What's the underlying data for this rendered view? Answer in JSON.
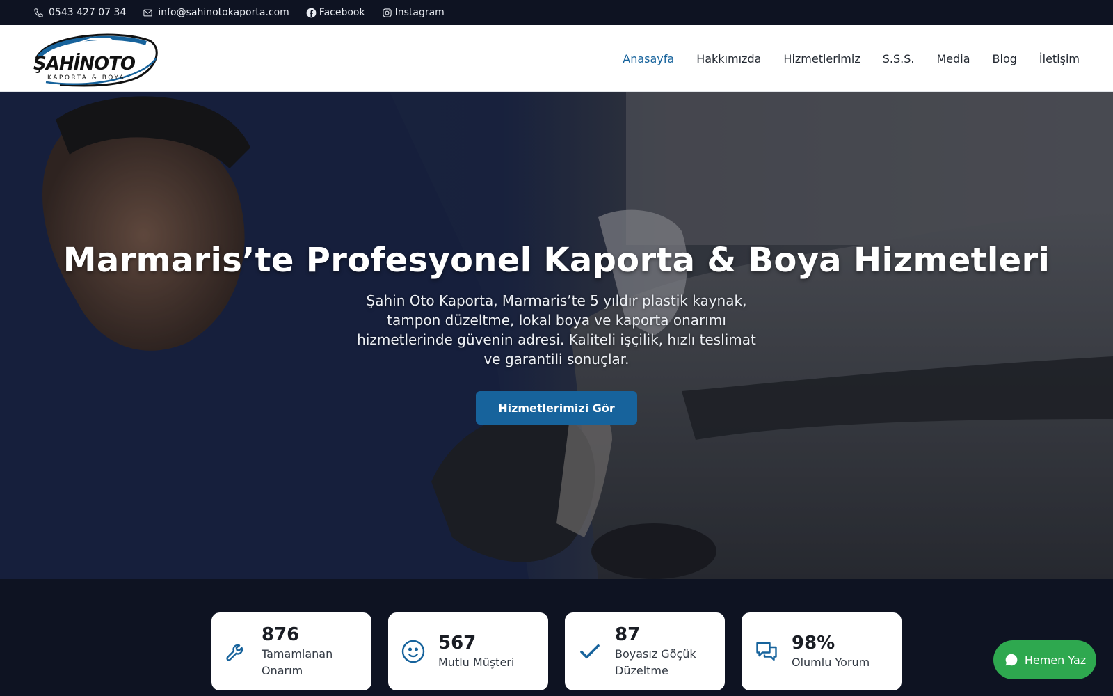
{
  "topbar": {
    "phone": "0543 427 07 34",
    "email": "info@sahinotokaporta.com",
    "facebook": "Facebook",
    "instagram": "Instagram"
  },
  "logo": {
    "brand": "ŞAHİNOTO",
    "tagline": "KAPORTA & BOYA"
  },
  "nav": {
    "items": [
      {
        "label": "Anasayfa",
        "active": true
      },
      {
        "label": "Hakkımızda",
        "active": false
      },
      {
        "label": "Hizmetlerimiz",
        "active": false
      },
      {
        "label": "S.S.S.",
        "active": false
      },
      {
        "label": "Media",
        "active": false
      },
      {
        "label": "Blog",
        "active": false
      },
      {
        "label": "İletişim",
        "active": false
      }
    ]
  },
  "hero": {
    "title": "Marmaris’te Profesyonel Kaporta & Boya Hizmetleri",
    "subtitle": "Şahin Oto Kaporta, Marmaris’te 5 yıldır plastik kaynak, tampon düzeltme, lokal boya ve kaporta onarımı hizmetlerinde güvenin adresi. Kaliteli işçilik, hızlı teslimat ve garantili sonuçlar.",
    "cta": "Hizmetlerimizi Gör"
  },
  "stats": [
    {
      "icon": "wrench-icon",
      "value": "876",
      "label": "Tamamlanan Onarım"
    },
    {
      "icon": "smiley-icon",
      "value": "567",
      "label": "Mutlu Müşteri"
    },
    {
      "icon": "check-icon",
      "value": "87",
      "label": "Boyasız Göçük Düzeltme"
    },
    {
      "icon": "chat-bubbles-icon",
      "value": "98%",
      "label": "Olumlu Yorum"
    }
  ],
  "whatsapp": {
    "label": "Hemen Yaz",
    "icon": "whatsapp-icon"
  },
  "colors": {
    "primary": "#17639c",
    "dark": "#0e1322",
    "whatsapp": "#2ea84f"
  }
}
